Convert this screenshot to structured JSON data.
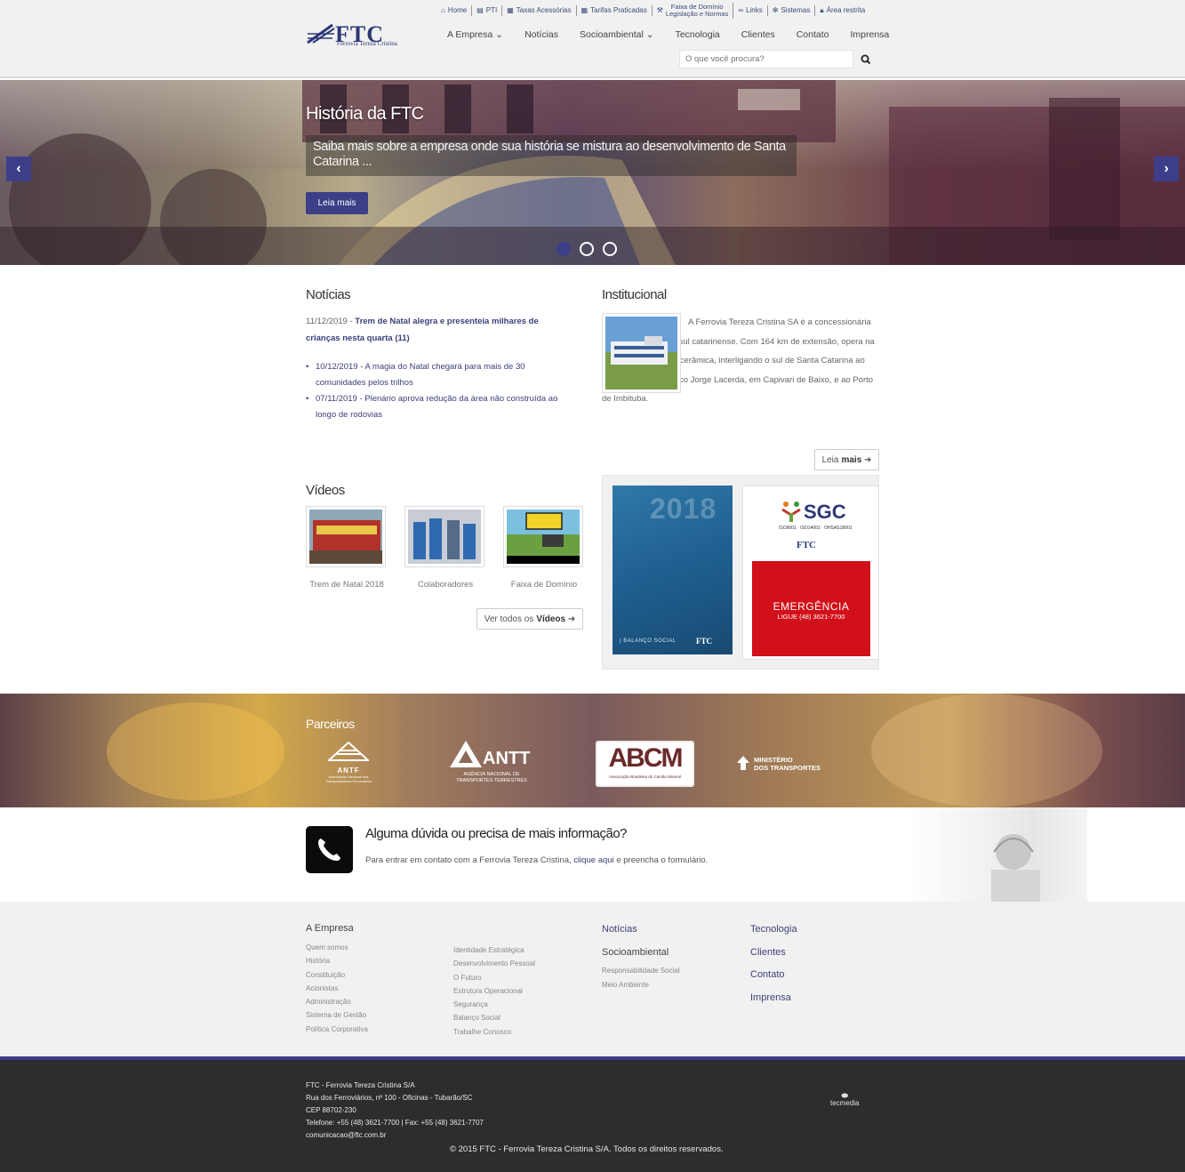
{
  "header": {
    "logo_text": "FTC",
    "logo_sub": "Ferrovia Tereza Cristina",
    "top_links": [
      {
        "icon": "home-icon",
        "label": "Home"
      },
      {
        "icon": "book-icon",
        "label": "PTI"
      },
      {
        "icon": "document-icon",
        "label": "Taxas Acessórias"
      },
      {
        "icon": "document-icon",
        "label": "Tarifas Praticadas"
      },
      {
        "icon": "gavel-icon",
        "label": "Faixa de Domínio",
        "label2": "Legislação e Normas"
      },
      {
        "icon": "link-icon",
        "label": "Links"
      },
      {
        "icon": "gear-icon",
        "label": "Sistemas"
      },
      {
        "icon": "lock-icon",
        "label": "Área restrita"
      }
    ],
    "nav": [
      "A Empresa",
      "Notícias",
      "Socioambiental",
      "Tecnologia",
      "Clientes",
      "Contato",
      "Imprensa"
    ],
    "search_placeholder": "O que você procura?"
  },
  "hero": {
    "title": "História da FTC",
    "description": "Saiba mais sobre a empresa onde sua história se mistura ao desenvolvimento de Santa Catarina ...",
    "button": "Leia mais",
    "slides": 3,
    "active_slide": 1
  },
  "news": {
    "title": "Notícias",
    "featured_date": "11/12/2019 - ",
    "featured_title": "Trem de Natal alegra e presenteia milhares de crianças nesta quarta (11)",
    "items": [
      "10/12/2019 - A magia do Natal chegará para mais de 30 comunidades pelos trilhos",
      "07/11/2019 - Plenário aprova redução da área não construída ao longo de rodovias"
    ]
  },
  "institutional": {
    "title": "Institucional",
    "text": "A Ferrovia Tereza Cristina SA é a concessionária da malha ferroviária sul catarinense. Com 164 km de extensão, opera na região carbonífera e cerâmica, interligando o sul de Santa Catarina ao Complexo Termelétrico Jorge Lacerda, em Capivari de Baixo, e ao Porto de Imbituba.",
    "button_prefix": "Leia",
    "button_bold": "mais"
  },
  "videos": {
    "title": "Vídeos",
    "items": [
      "Trem de Natal 2018",
      "Colaboradores",
      "Faixa de Domínio"
    ],
    "button_prefix": "Ver todos os",
    "button_bold": "Vídeos"
  },
  "promo": {
    "year": "2018",
    "report": "| BALANÇO SOCIAL",
    "report_logo": "FTC",
    "sgc": "SGC",
    "iso": "ISO9001 · ISO14001 · OHSAS18001",
    "sgc_logo": "FTC",
    "emergency": "EMERGÊNCIA",
    "emergency_phone": "LIGUE (48) 3621-7700"
  },
  "partners": {
    "title": "Parceiros",
    "antf": "ANTF",
    "antf_sub": "Associação Nacional dos Transportadores Ferroviários",
    "antt": "ANTT",
    "antt_sub": "AGÊNCIA NACIONAL DE TRANSPORTES TERRESTRES",
    "abcm": "ABCM",
    "abcm_sub": "Associação Brasileira do Carvão Mineral",
    "mt": "MINISTÉRIO",
    "mt2": "DOS TRANSPORTES"
  },
  "contact": {
    "title": "Alguma dúvida ou precisa de mais informação?",
    "text_before": "Para entrar em contato com a Ferrovia Tereza Cristina, ",
    "link": "clique aqui",
    "text_after": " e preencha o formulário."
  },
  "footer": {
    "empresa_title": "A Empresa",
    "col1": [
      "Quem somos",
      "História",
      "Constituição",
      "Acionistas",
      "Administração",
      "Sistema de Gestão",
      "Política Corporativa"
    ],
    "col2": [
      "Identidade Estratégica",
      "Desenvolvimento Pessoal",
      "O Futuro",
      "Estrutura Operacional",
      "Segurança",
      "Balanço Social",
      "Trabalhe Conosco"
    ],
    "noticias": "Notícias",
    "socioambiental": "Socioambiental",
    "col3": [
      "Responsabilidade Social",
      "Meio Ambiente"
    ],
    "col4": [
      "Tecnologia",
      "Clientes",
      "Contato",
      "Imprensa"
    ]
  },
  "bottom": {
    "address": [
      "FTC - Ferrovia Tereza Cristina S/A",
      "Rua dos Ferroviários, nº 100 - Oficinas - Tubarão/SC",
      "CEP 88702-230",
      "Telefone: +55 (48) 3621-7700 | Fax: +55 (48) 3621-7707",
      "comunicacao@ftc.com.br"
    ],
    "copyright": "© 2015 FTC - Ferrovia Tereza Cristina S/A. Todos os direitos reservados.",
    "credit": "tecmedia"
  },
  "colors": {
    "brand": "#3c3f87",
    "emergency": "#d2101a",
    "footer_bg": "#2d2d2d"
  }
}
